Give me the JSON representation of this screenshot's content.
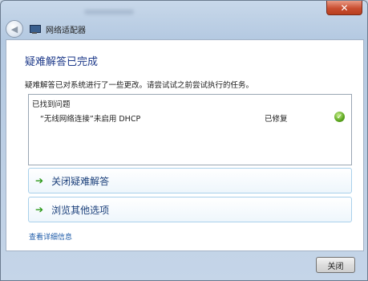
{
  "window": {
    "title": "网络适配器",
    "close_glyph": "✕"
  },
  "nav": {
    "back_glyph": "◀"
  },
  "main": {
    "heading": "疑难解答已完成",
    "description": "疑难解答已对系统进行了一些更改。请尝试试之前尝试执行的任务。",
    "results_header": "已找到问题",
    "problems": [
      {
        "name": "“无线网络连接”未启用 DHCP",
        "status": "已修复",
        "status_icon": "check-icon"
      }
    ],
    "options": [
      {
        "arrow": "➔",
        "label": "关闭疑难解答"
      },
      {
        "arrow": "➔",
        "label": "浏览其他选项"
      }
    ],
    "details_link": "查看详细信息"
  },
  "footer": {
    "close_button": "关闭"
  },
  "colors": {
    "heading": "#1e3a8a",
    "link": "#1c5aa8",
    "close_red": "#c94e31",
    "check_green": "#5aa51d"
  }
}
